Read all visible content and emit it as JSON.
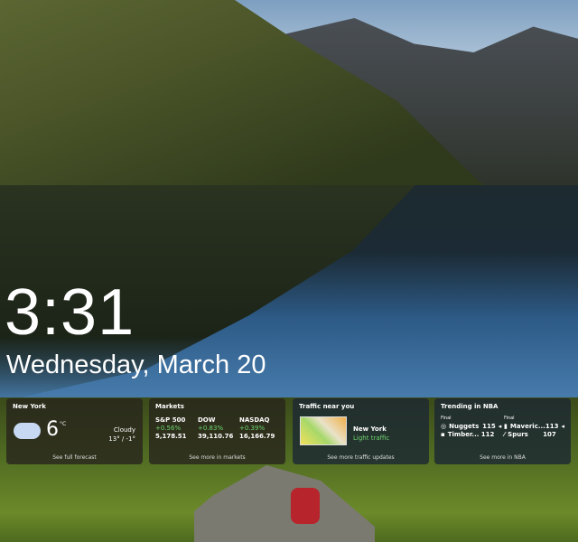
{
  "lock": {
    "time": "3:31",
    "date": "Wednesday, March 20"
  },
  "weather": {
    "title": "New York",
    "temp": "6",
    "unit": "°C",
    "condition": "Cloudy",
    "range": "13° / -1°",
    "footer": "See full forecast"
  },
  "markets": {
    "title": "Markets",
    "items": [
      {
        "name": "S&P 500",
        "change": "+0.56%",
        "value": "5,178.51"
      },
      {
        "name": "DOW",
        "change": "+0.83%",
        "value": "39,110.76"
      },
      {
        "name": "NASDAQ",
        "change": "+0.39%",
        "value": "16,166.79"
      }
    ],
    "footer": "See more in markets",
    "up_color": "#6fd36f"
  },
  "traffic": {
    "title": "Traffic near you",
    "city": "New York",
    "status": "Light traffic",
    "footer": "See more traffic updates"
  },
  "nba": {
    "title": "Trending in NBA",
    "games": [
      {
        "status": "Final",
        "teams": [
          {
            "name": "Nuggets",
            "score": "115",
            "winner": true
          },
          {
            "name": "Timber...",
            "score": "112"
          }
        ]
      },
      {
        "status": "Final",
        "teams": [
          {
            "name": "Maveric...",
            "score": "113",
            "winner": true
          },
          {
            "name": "Spurs",
            "score": "107"
          }
        ]
      }
    ],
    "footer": "See more in NBA"
  }
}
